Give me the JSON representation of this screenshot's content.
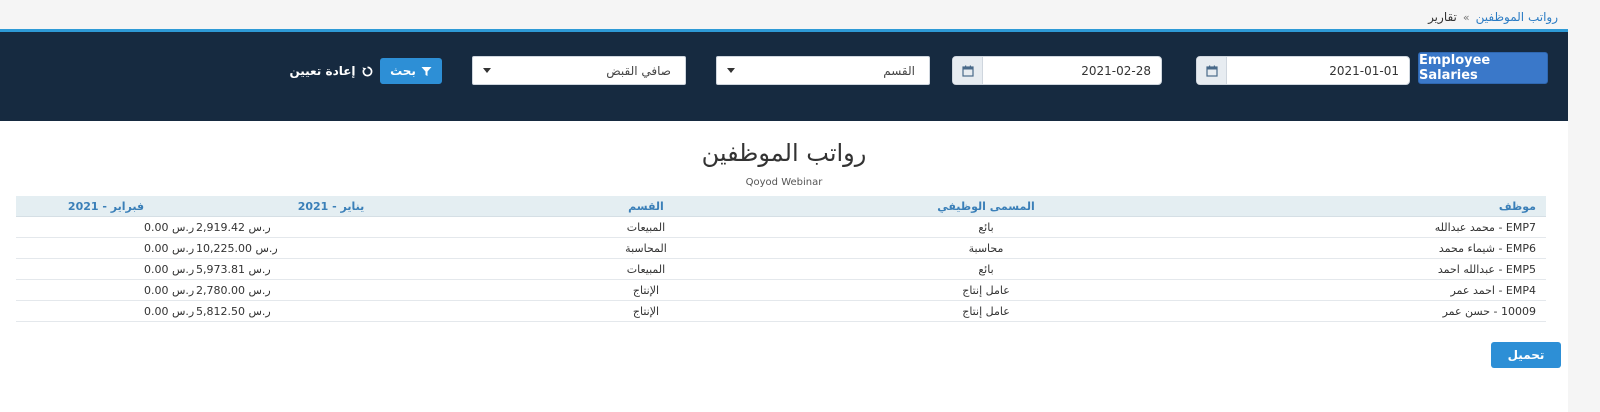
{
  "breadcrumb": {
    "root": "تقارير",
    "separator": "»",
    "current": "رواتب الموظفين"
  },
  "filters": {
    "report_button": "Employee Salaries",
    "date_from": "2021-01-01",
    "date_to": "2021-02-28",
    "department_select": "القسم",
    "pay_type_select": "صافي القبض",
    "search_button": "بحث",
    "reset_button": "إعادة تعيين"
  },
  "report": {
    "title": "رواتب الموظفين",
    "subtitle": "Qoyod Webinar",
    "columns": [
      "موظف",
      "المسمى الوظيفي",
      "القسم",
      "يناير - 2021",
      "فبراير - 2021"
    ],
    "rows": [
      {
        "employee": "EMP7 - محمد عبدالله",
        "job_title": "بائع",
        "department": "المبيعات",
        "jan": "2,919.42 ر.س",
        "feb": "0.00 ر.س"
      },
      {
        "employee": "EMP6 - شيماء محمد",
        "job_title": "محاسبة",
        "department": "المحاسبة",
        "jan": "10,225.00 ر.س",
        "feb": "0.00 ر.س"
      },
      {
        "employee": "EMP5 - عبدالله احمد",
        "job_title": "بائع",
        "department": "المبيعات",
        "jan": "5,973.81 ر.س",
        "feb": "0.00 ر.س"
      },
      {
        "employee": "EMP4 - احمد عمر",
        "job_title": "عامل إنتاج",
        "department": "الإنتاج",
        "jan": "2,780.00 ر.س",
        "feb": "0.00 ر.س"
      },
      {
        "employee": "10009 - حسن عمر",
        "job_title": "عامل إنتاج",
        "department": "الإنتاج",
        "jan": "5,812.50 ر.س",
        "feb": "0.00 ر.س"
      }
    ]
  },
  "download_button": "تحميل",
  "colors": {
    "header_bg": "#162a40",
    "accent": "#2d8fd6",
    "report_button": "#3a78c9"
  }
}
